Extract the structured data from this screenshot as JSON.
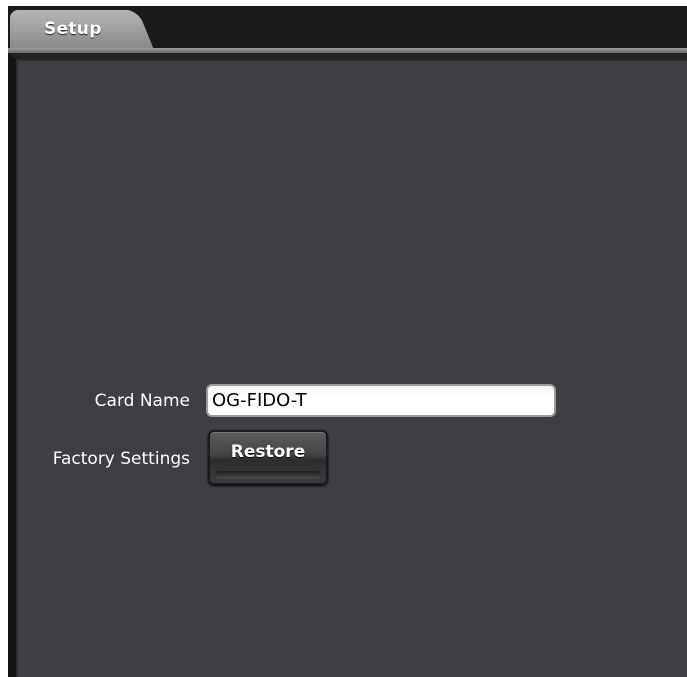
{
  "tabs": [
    {
      "label": "Setup",
      "active": true
    }
  ],
  "form": {
    "card_name_label": "Card Name",
    "card_name_value": "OG-FIDO-T",
    "factory_settings_label": "Factory Settings",
    "restore_label": "Restore"
  },
  "colors": {
    "panel_background": "#3f3f43",
    "tab_background": "#9e9e9e",
    "label_text": "#ffffff"
  }
}
